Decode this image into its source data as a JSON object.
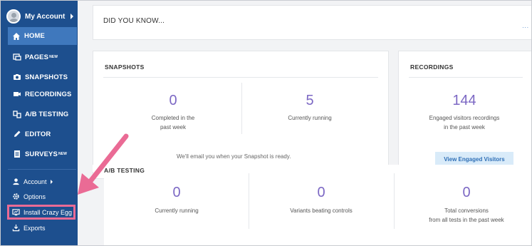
{
  "sidebar": {
    "account_top": "My Account",
    "items": [
      {
        "label": "HOME",
        "icon": "home-icon"
      },
      {
        "label": "PAGES",
        "badge": "NEW",
        "icon": "pages-icon"
      },
      {
        "label": "SNAPSHOTS",
        "icon": "camera-icon"
      },
      {
        "label": "RECORDINGS",
        "icon": "video-icon"
      },
      {
        "label": "A/B TESTING",
        "icon": "ab-icon"
      },
      {
        "label": "EDITOR",
        "icon": "pencil-icon"
      },
      {
        "label": "SURVEYS",
        "badge": "NEW",
        "icon": "survey-icon"
      }
    ],
    "sub": {
      "account": "Account",
      "options": "Options",
      "install": "Install Crazy Egg",
      "exports": "Exports"
    }
  },
  "did_you_know": {
    "title": "DID YOU KNOW...",
    "dots": "..."
  },
  "snapshots": {
    "title": "SNAPSHOTS",
    "completed_value": "0",
    "completed_label_1": "Completed in the",
    "completed_label_2": "past week",
    "running_value": "5",
    "running_label": "Currently running",
    "note": "We'll email you when your Snapshot is ready."
  },
  "recordings": {
    "title": "RECORDINGS",
    "value": "144",
    "label_1": "Engaged visitors recordings",
    "label_2": "in the past week",
    "button": "View Engaged Visitors"
  },
  "ab_testing": {
    "title": "A/B TESTING",
    "running_value": "0",
    "running_label": "Currently running",
    "variants_value": "0",
    "variants_label": "Variants beating controls",
    "conversions_value": "0",
    "conversions_label_1": "Total conversions",
    "conversions_label_2": "from all tests in the past week"
  },
  "colors": {
    "sidebar": "#1d4f8e",
    "home_active": "#3f78bd",
    "stat": "#7c68c4",
    "highlight": "#ea6b95",
    "button_bg": "#d9ebf9"
  }
}
